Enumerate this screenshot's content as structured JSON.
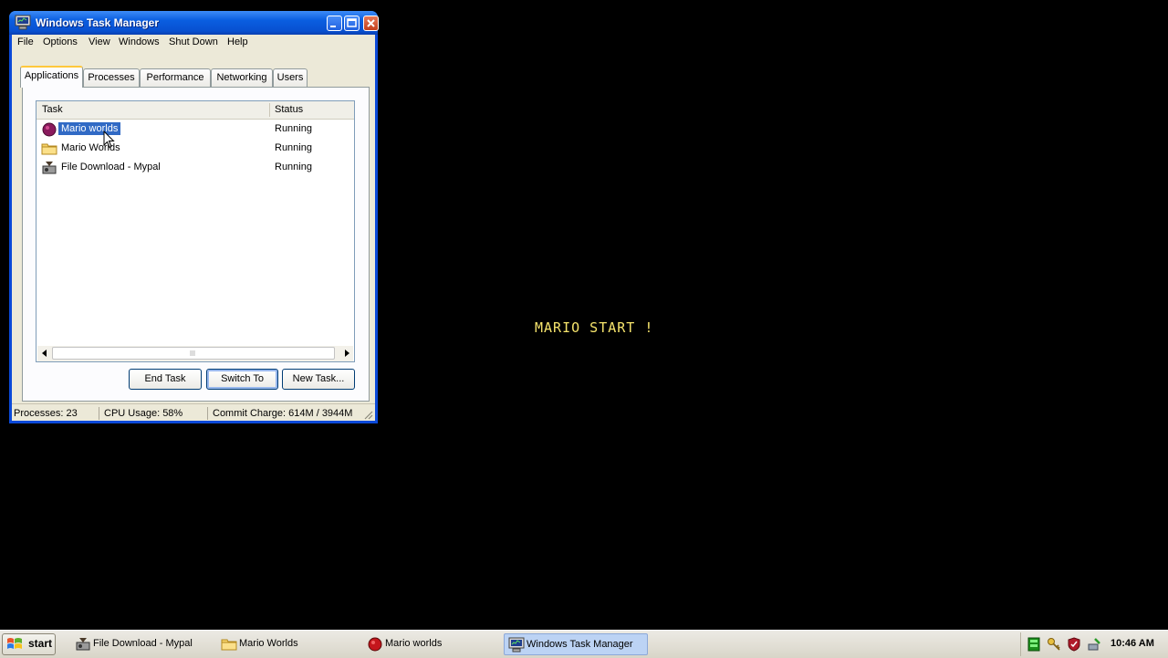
{
  "game": {
    "message": "MARIO START !"
  },
  "window": {
    "title": "Windows Task Manager",
    "menu": [
      "File",
      "Options",
      "View",
      "Windows",
      "Shut Down",
      "Help"
    ],
    "tabs": [
      "Applications",
      "Processes",
      "Performance",
      "Networking",
      "Users"
    ],
    "active_tab": "Applications",
    "list": {
      "columns": [
        "Task",
        "Status"
      ],
      "rows": [
        {
          "task": "Mario worlds",
          "status": "Running",
          "icon": "mario-icon",
          "selected": true
        },
        {
          "task": "Mario Worlds",
          "status": "Running",
          "icon": "folder-icon",
          "selected": false
        },
        {
          "task": "File Download - Mypal",
          "status": "Running",
          "icon": "download-icon",
          "selected": false
        }
      ]
    },
    "buttons": {
      "end_task": "End Task",
      "switch_to": "Switch To",
      "new_task": "New Task..."
    },
    "status": {
      "processes": "Processes: 23",
      "cpu": "CPU Usage: 58%",
      "commit": "Commit Charge: 614M / 3944M"
    }
  },
  "taskbar": {
    "start_label": "start",
    "items": [
      {
        "label": "File Download - Mypal",
        "icon": "download-icon",
        "active": false
      },
      {
        "label": "Mario Worlds",
        "icon": "folder-icon",
        "active": false
      },
      {
        "label": "Mario worlds",
        "icon": "mario-icon",
        "active": false
      },
      {
        "label": "Windows Task Manager",
        "icon": "task-manager-icon",
        "active": true
      }
    ],
    "clock": "10:46 AM"
  },
  "colors": {
    "selection": "#316ac5",
    "titlebar": "#0a5ee0",
    "game_text": "#f6e46c"
  }
}
